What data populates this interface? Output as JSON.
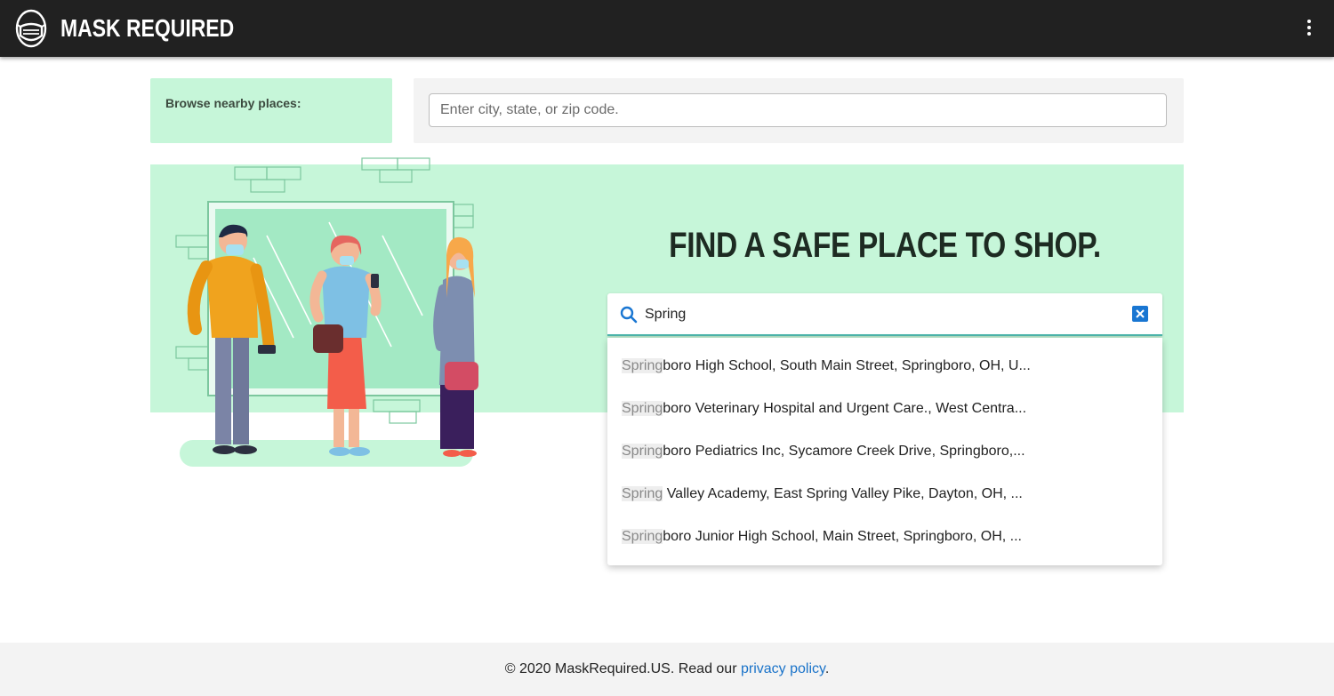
{
  "header": {
    "brand": "MASK REQUIRED",
    "logo_icon": "mask-icon",
    "menu_icon": "more-vert-icon"
  },
  "browse": {
    "label": "Browse nearby places:",
    "placeholder": "Enter city, state, or zip code."
  },
  "hero": {
    "headline": "FIND A SAFE PLACE TO SHOP."
  },
  "search": {
    "value": "Spring",
    "icon": "search-icon",
    "clear_icon": "close-icon",
    "results": [
      {
        "match": "Spring",
        "rest": "boro High School, South Main Street, Springboro, OH, U..."
      },
      {
        "match": "Spring",
        "rest": "boro Veterinary Hospital and Urgent Care., West Centra..."
      },
      {
        "match": "Spring",
        "rest": "boro Pediatrics Inc, Sycamore Creek Drive, Springboro,..."
      },
      {
        "match": "Spring",
        "rest": " Valley Academy, East Spring Valley Pike, Dayton, OH, ..."
      },
      {
        "match": "Spring",
        "rest": "boro Junior High School, Main Street, Springboro, OH, ..."
      }
    ]
  },
  "footer": {
    "prefix": "© 2020 MaskRequired.US. Read our ",
    "link": "privacy policy",
    "suffix": "."
  },
  "colors": {
    "header_bg": "#212121",
    "mint": "#c6f6d9",
    "panel_gray": "#f3f3f3",
    "link_blue": "#1a73c9",
    "headline": "#1d2b22"
  }
}
